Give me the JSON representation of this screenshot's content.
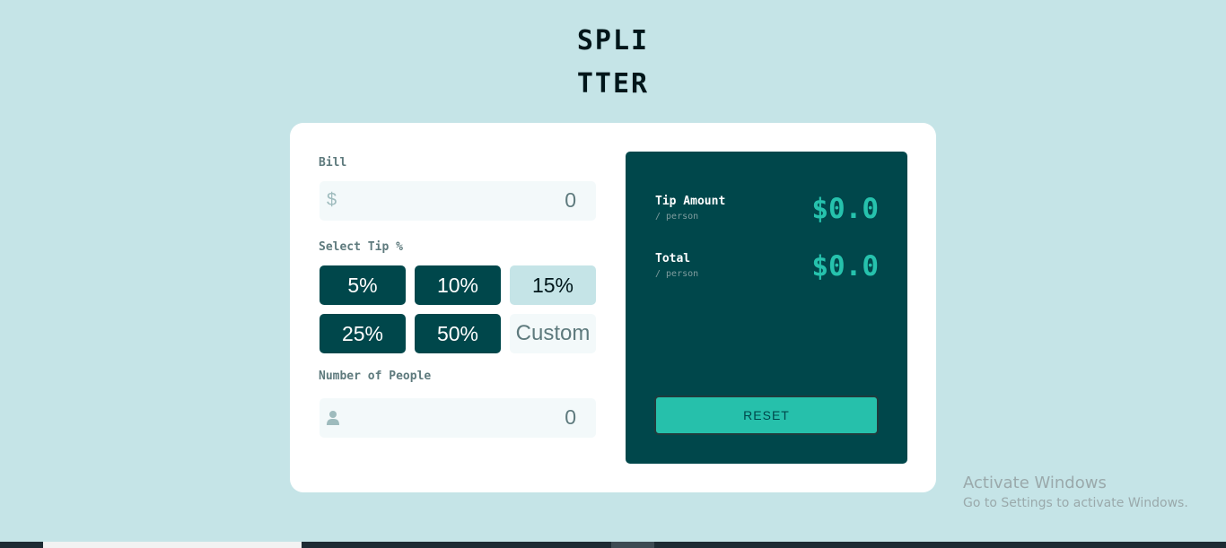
{
  "logo": {
    "line1": "SPLI",
    "line2": "TTER"
  },
  "bill": {
    "label": "Bill",
    "prefix": "$",
    "value": "0"
  },
  "tip": {
    "label": "Select Tip %",
    "options": [
      "5%",
      "10%",
      "15%",
      "25%",
      "50%"
    ],
    "custom_placeholder": "Custom",
    "selected": "15%"
  },
  "people": {
    "label": "Number of People",
    "value": "0"
  },
  "results": {
    "tip_label": "Tip Amount",
    "tip_sub": "/ person",
    "tip_value": "$0.0",
    "total_label": "Total",
    "total_sub": "/ person",
    "total_value": "$0.0",
    "reset_label": "RESET"
  },
  "watermark": {
    "title": "Activate Windows",
    "subtitle": "Go to Settings to activate Windows."
  },
  "colors": {
    "background": "#c5e4e7",
    "dark_cyan": "#00474b",
    "strong_cyan": "#26c2ad",
    "input_bg": "#f3f9fa"
  },
  "icons": {
    "bill_prefix": "dollar-icon",
    "people_prefix": "person-icon"
  }
}
